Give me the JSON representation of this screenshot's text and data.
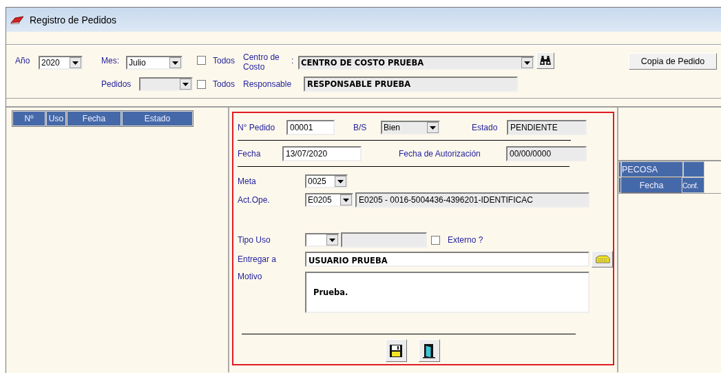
{
  "window": {
    "title": "Registro de Pedidos"
  },
  "filters": {
    "year": {
      "label": "Año",
      "value": "2020"
    },
    "month": {
      "label": "Mes:",
      "value": "Julio"
    },
    "all_months": {
      "label": "Todos",
      "checked": false
    },
    "orders": {
      "label": "Pedidos"
    },
    "all_orders": {
      "label": "Todos",
      "checked": false
    },
    "cost_center": {
      "label": "Centro de Costo",
      "separator": ":",
      "value": "CENTRO DE COSTO PRUEBA"
    },
    "responsible": {
      "label": "Responsable",
      "value": "RESPONSABLE PRUEBA"
    },
    "copy_button": "Copia de Pedido"
  },
  "orders_table": {
    "columns": [
      "Nº",
      "Uso",
      "Fecha",
      "Estado"
    ]
  },
  "form": {
    "order_no": {
      "label": "N° Pedido",
      "value": "00001"
    },
    "goods_services": {
      "label": "B/S",
      "value": "Bien"
    },
    "status": {
      "label": "Estado",
      "value": "PENDIENTE"
    },
    "date": {
      "label": "Fecha",
      "value": "13/07/2020"
    },
    "auth_date": {
      "label": "Fecha de Autorización",
      "value": "00/00/0000"
    },
    "goal": {
      "label": "Meta",
      "value": "0025"
    },
    "activity": {
      "label": "Act.Ope.",
      "code": "E0205",
      "description": "E0205 - 0016-5004436-4396201-IDENTIFICAC"
    },
    "use_type": {
      "label": "Tipo Uso"
    },
    "external": {
      "label": "Externo ?",
      "checked": false
    },
    "deliver_to": {
      "label": "Entregar a",
      "value": "USUARIO PRUEBA"
    },
    "reason": {
      "label": "Motivo",
      "value": "Prueba."
    }
  },
  "pecosa_table": {
    "group": "PECOSA",
    "columns": [
      "Fecha",
      "Conf."
    ]
  }
}
